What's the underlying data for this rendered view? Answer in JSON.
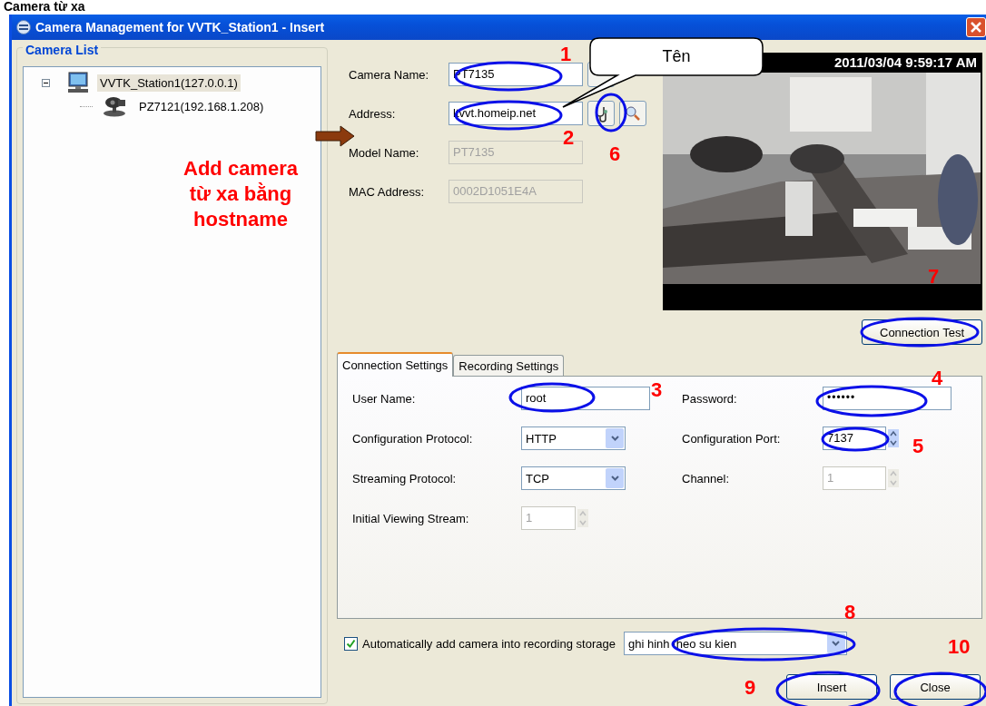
{
  "heading": "Camera từ xa",
  "window": {
    "title": "Camera Management for VVTK_Station1 - Insert"
  },
  "camera_list": {
    "title": "Camera List",
    "tree": [
      {
        "label": "VVTK_Station1(127.0.0.1)",
        "kind": "station",
        "selected": true,
        "expanded": true,
        "children": [
          {
            "label": "PZ7121(192.168.1.208)",
            "kind": "camera",
            "selected": false
          }
        ]
      }
    ]
  },
  "fields": [
    {
      "label": "Camera Name:",
      "value": "PT7135",
      "disabled": false,
      "kind": "browse"
    },
    {
      "label": "Address:",
      "value": "ltvvt.homeip.net",
      "disabled": false,
      "kind": "address"
    },
    {
      "label": "Model Name:",
      "value": "PT7135",
      "disabled": true,
      "kind": "plain"
    },
    {
      "label": "MAC Address:",
      "value": "0002D1051E4A",
      "disabled": true,
      "kind": "plain"
    }
  ],
  "preview": {
    "timestamp": "2011/03/04 9:59:17 AM"
  },
  "connection_test": "Connection Test",
  "tabs": [
    {
      "label": "Connection Settings",
      "selected": true
    },
    {
      "label": "Recording Settings",
      "selected": false
    }
  ],
  "settings_left": [
    {
      "label": "User Name:",
      "kind": "text",
      "value": "root",
      "disabled": false
    },
    {
      "label": "Configuration Protocol:",
      "kind": "combo",
      "value": "HTTP",
      "disabled": false
    },
    {
      "label": "Streaming Protocol:",
      "kind": "combo",
      "value": "TCP",
      "disabled": false
    },
    {
      "label": "Initial Viewing Stream:",
      "kind": "spin",
      "value": "1",
      "disabled": true
    }
  ],
  "settings_right": [
    {
      "label": "Password:",
      "kind": "password",
      "value": "••••••",
      "disabled": false
    },
    {
      "label": "Configuration Port:",
      "kind": "spin",
      "value": "7137",
      "disabled": false
    },
    {
      "label": "Channel:",
      "kind": "spin",
      "value": "1",
      "disabled": true
    }
  ],
  "auto_add": {
    "label": "Automatically add camera into recording storage",
    "checked": true,
    "storage": "ghi hinh theo su kien"
  },
  "buttons": [
    "Insert",
    "Close"
  ],
  "callout": "Tên",
  "note": "Add camera từ xa bằng hostname",
  "markers": [
    "1",
    "2",
    "3",
    "4",
    "5",
    "6",
    "7",
    "8",
    "9",
    "10"
  ]
}
